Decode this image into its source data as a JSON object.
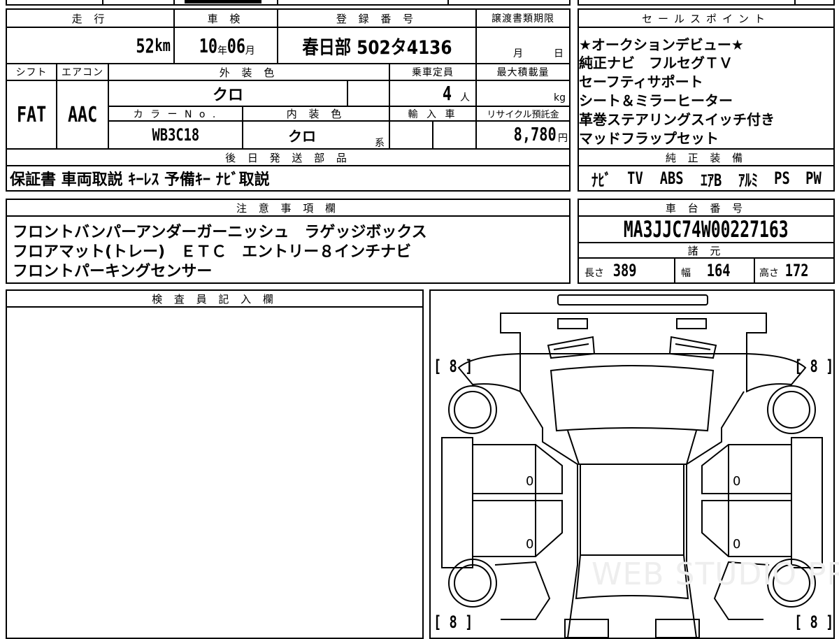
{
  "top_block": {
    "headers": {
      "mileage": "走 行",
      "inspection": "車 検",
      "registration": "登 録 番 号",
      "transfer_deadline": "譲渡書類期限",
      "shift": "シフト",
      "aircon": "エアコン",
      "exterior_color": "外 装 色",
      "capacity": "乗車定員",
      "max_load": "最大積載量",
      "color_no": "カ ラ ー N o .",
      "interior_color": "内 装 色",
      "import": "輸 入 車",
      "recycle_fee": "リサイクル預託金"
    },
    "mileage": {
      "value": "52",
      "unit": "km"
    },
    "inspection": {
      "year": "10",
      "year_unit": "年",
      "month": "06",
      "month_unit": "月"
    },
    "registration": "春日部 502タ4136",
    "transfer_deadline": {
      "month_unit": "月",
      "day_unit": "日"
    },
    "shift": "FAT",
    "aircon": "AAC",
    "exterior_color": "クロ",
    "capacity": {
      "value": "4",
      "unit": "人"
    },
    "max_load": {
      "unit": "kg"
    },
    "color_no": "WB3C18",
    "interior_color": {
      "value": "クロ",
      "suffix": "系"
    },
    "recycle_fee": {
      "value": "8,780",
      "unit": "円"
    }
  },
  "later_parts": {
    "header": "後 日 発 送 部 品",
    "content": "保証書 車両取説 ｷｰﾚｽ 予備ｷｰ ﾅﾋﾞ取説"
  },
  "sales_points": {
    "header": "セールスポイント",
    "lines": [
      "★オークションデビュー★",
      "純正ナビ　フルセグＴＶ",
      "セーフティサポート",
      "シート＆ミラーヒーター",
      "革巻ステアリングスイッチ付き",
      "マッドフラップセット"
    ]
  },
  "genuine_equipment": {
    "header": "純 正 装 備",
    "items": [
      "ﾅﾋﾞ",
      "TV",
      "ABS",
      "ｴｱB",
      "ｱﾙﾐ",
      "PS",
      "PW"
    ]
  },
  "notes": {
    "header": "注 意 事 項 欄",
    "lines": [
      "フロントバンパーアンダーガーニッシュ　ラゲッジボックス",
      "フロアマット(トレー)　ＥＴＣ　エントリー８インチナビ",
      "フロントパーキングセンサー"
    ]
  },
  "chassis": {
    "header": "車 台 番 号",
    "number": "MA3JJC74W00227163"
  },
  "specs": {
    "header": "諸 元",
    "length_label": "長さ",
    "length": "389",
    "width_label": "幅",
    "width": "164",
    "height_label": "高さ",
    "height": "172"
  },
  "inspector": {
    "header": "検 査 員 記 入 欄"
  },
  "diagram": {
    "tire_front_left": "[ 8 ]",
    "tire_front_right": "[ 8 ]",
    "tire_rear_left": "[ 8 ]",
    "tire_rear_right": "[ 8 ]",
    "door_fl": "0",
    "door_fr": "0",
    "door_rl": "0",
    "door_rr": "0",
    "watermark": "WEB STUDIO PRO"
  }
}
